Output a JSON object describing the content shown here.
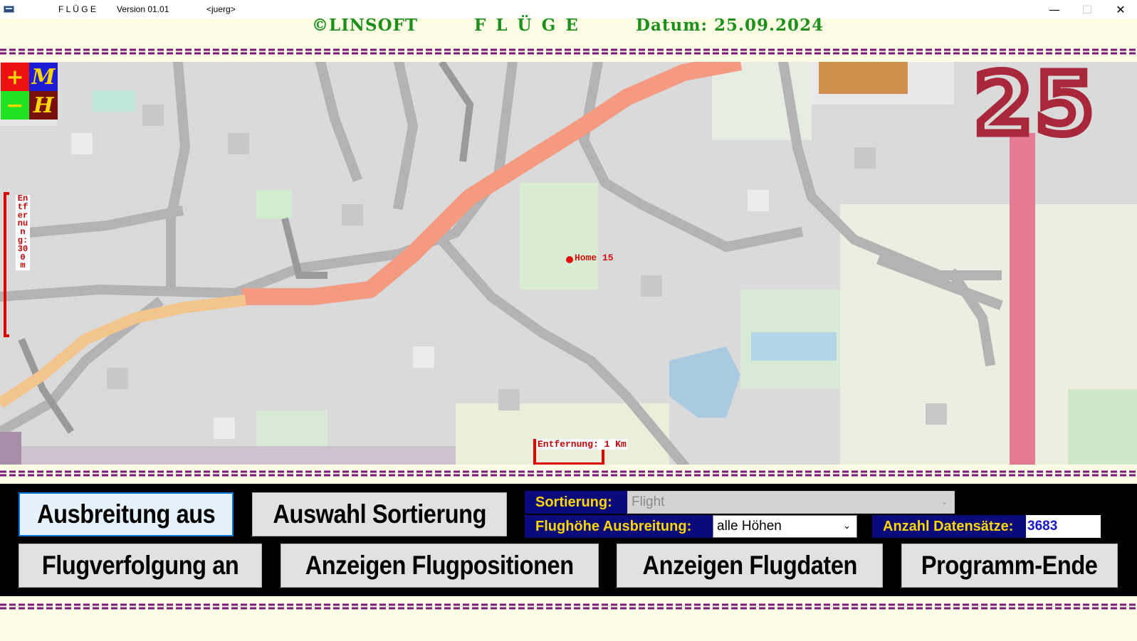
{
  "window": {
    "app_name": "F L Ü G E",
    "version": "Version 01.01",
    "user": "<juerg>",
    "minimize": "—",
    "maximize": "☐",
    "close": "✕"
  },
  "header": {
    "copyright": "©LINSOFT",
    "title": "F L Ü G E",
    "date": "Datum: 25.09.2024"
  },
  "map": {
    "zoom_in": "+",
    "zoom_out": "−",
    "map_mode": "M",
    "home": "H",
    "home_label": "Home 15",
    "scale_vertical": "Entfernung: 300 m",
    "scale_horizontal": "Entfernung: 1 Km",
    "road_number": "25"
  },
  "controls": {
    "ausbreitung_btn": "Ausbreitung aus",
    "auswahl_btn": "Auswahl Sortierung",
    "sortierung_label": "Sortierung:",
    "sortierung_value": "Flight",
    "flughoehe_label": "Flughöhe Ausbreitung:",
    "flughoehe_value": "alle Höhen",
    "anzahl_label": "Anzahl Datensätze:",
    "anzahl_value": "3683",
    "flugverfolgung_btn": "Flugverfolgung an",
    "flugpositionen_btn": "Anzeigen Flugpositionen",
    "flugdaten_btn": "Anzeigen Flugdaten",
    "programm_ende_btn": "Programm-Ende"
  },
  "colors": {
    "accent_green": "#1c8f1c",
    "label_bg": "#0a0a7a",
    "label_fg": "#ffd700",
    "dash_purple": "#7a1a7a",
    "scale_red": "#e00000"
  }
}
